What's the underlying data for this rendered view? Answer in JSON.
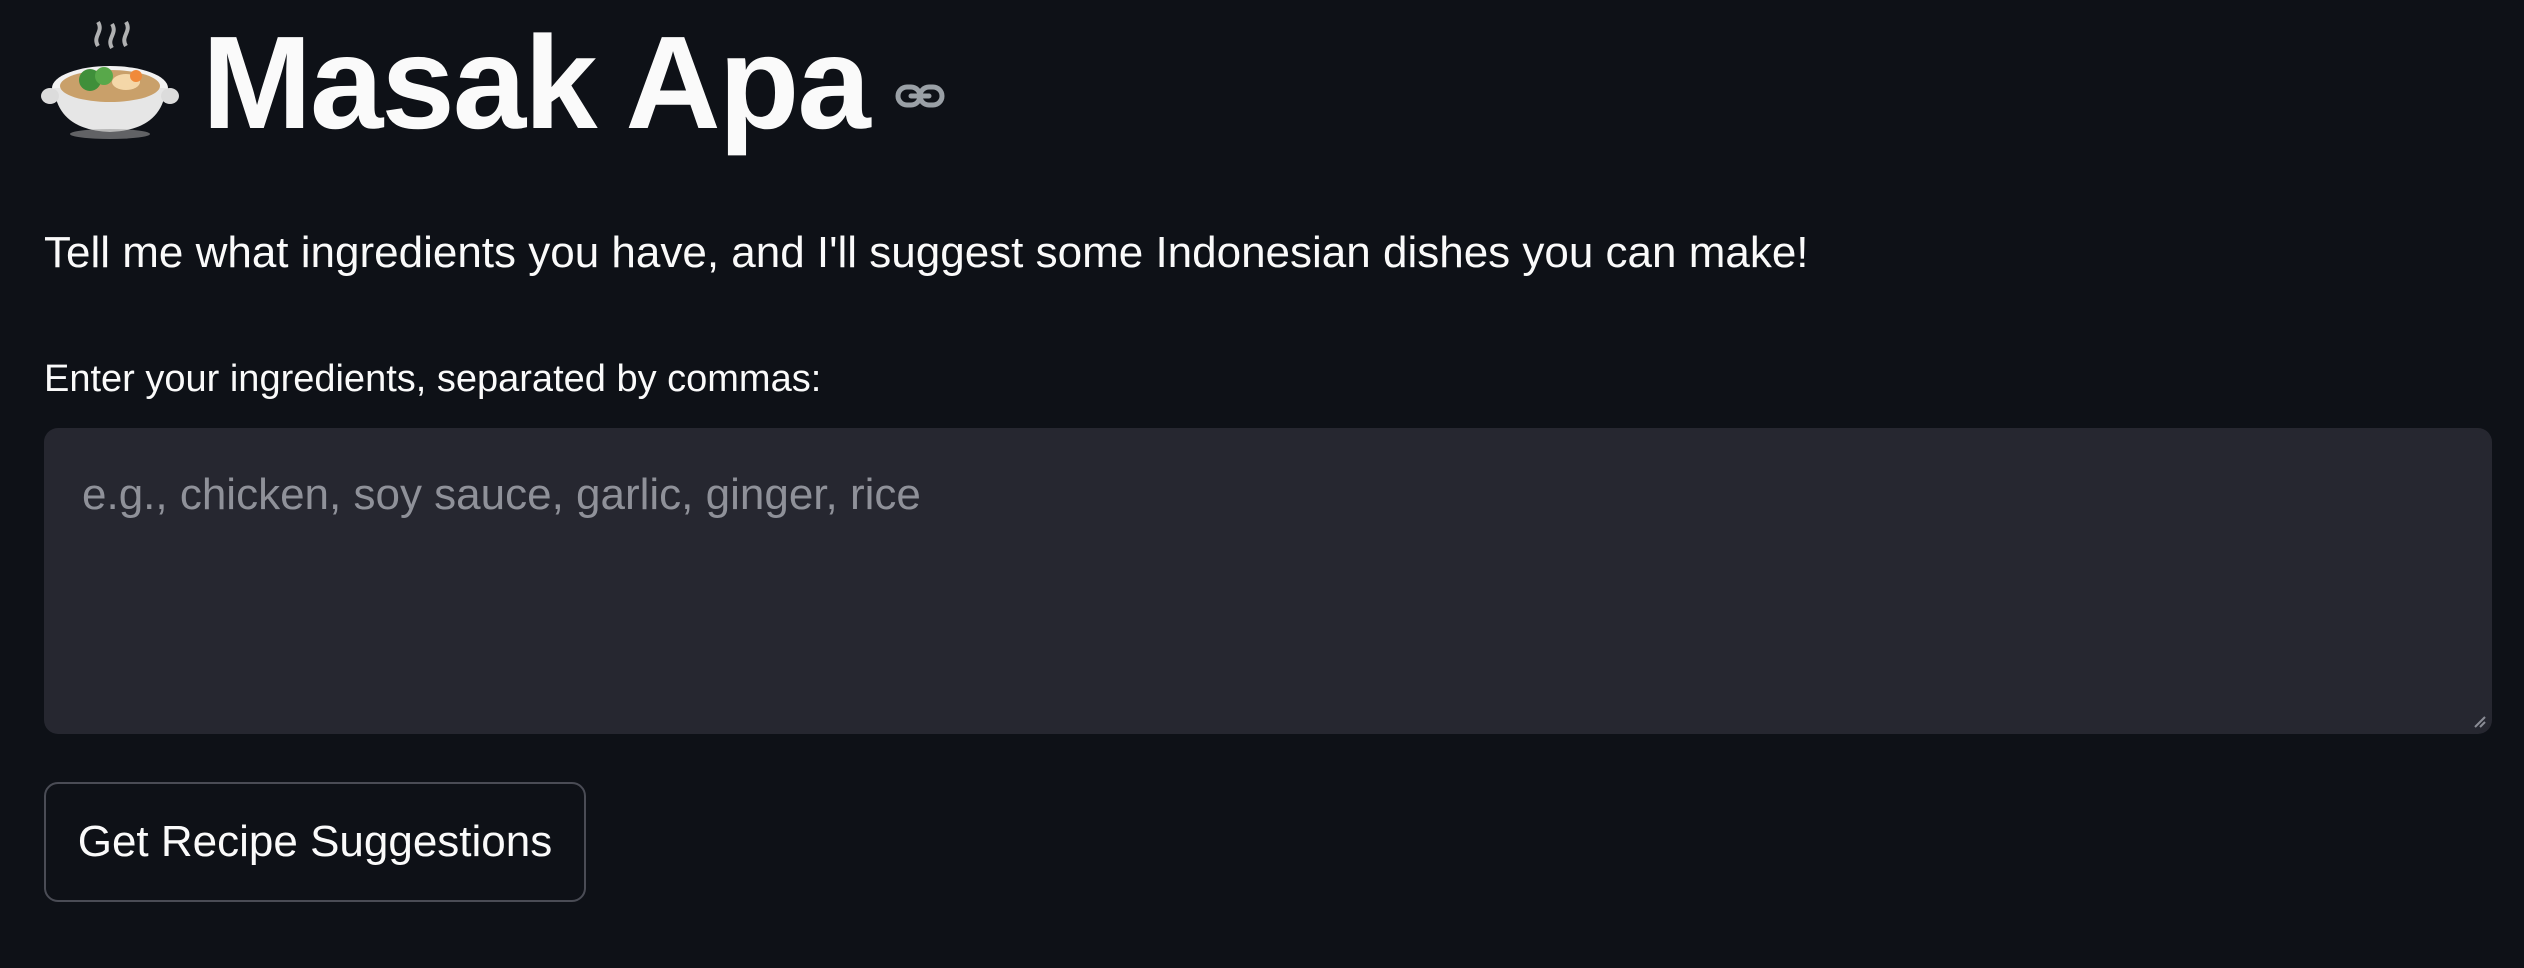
{
  "app": {
    "title": "Masak Apa",
    "title_icon": "pot-of-food-emoji",
    "anchor_icon": "link-icon"
  },
  "main": {
    "description": "Tell me what ingredients you have, and I'll suggest some Indonesian dishes you can make!",
    "ingredients_label": "Enter your ingredients, separated by commas:",
    "ingredients_placeholder": "e.g., chicken, soy sauce, garlic, ginger, rice",
    "ingredients_value": "",
    "submit_label": "Get Recipe Suggestions"
  },
  "colors": {
    "background": "#0e1117",
    "text": "#fafafa",
    "input_bg": "#262730",
    "placeholder": "#8f9199",
    "button_border": "#4a4c55"
  }
}
